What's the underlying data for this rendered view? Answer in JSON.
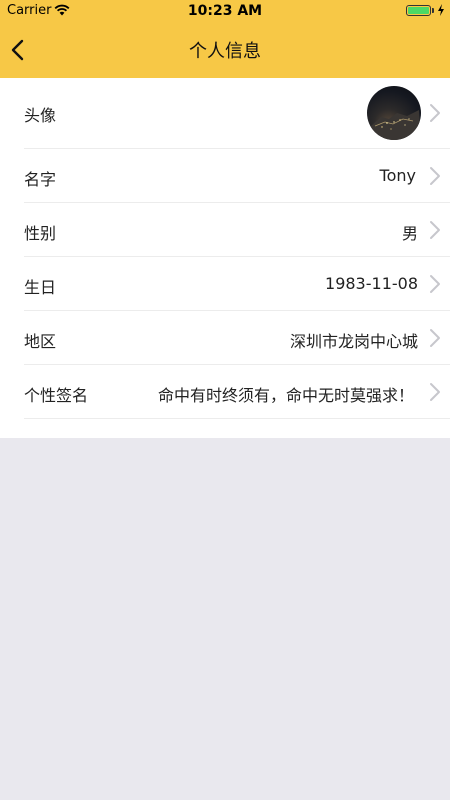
{
  "status_bar": {
    "carrier": "Carrier",
    "time": "10:23 AM",
    "battery_level": 1.0
  },
  "nav": {
    "title": "个人信息",
    "back_icon": "chevron-left-icon"
  },
  "profile_rows": [
    {
      "label": "头像",
      "value": ""
    },
    {
      "label": "名字",
      "value": "Tony"
    },
    {
      "label": "性别",
      "value": "男"
    },
    {
      "label": "生日",
      "value": "1983-11-08"
    },
    {
      "label": "地区",
      "value": "深圳市龙岗中心城"
    },
    {
      "label": "个性签名",
      "value": "命中有时终须有，命中无时莫强求！"
    }
  ],
  "colors": {
    "header_bg": "#f7c846",
    "page_bg": "#e9e8ee",
    "list_bg": "#ffffff",
    "chevron": "#c7c7cc"
  }
}
